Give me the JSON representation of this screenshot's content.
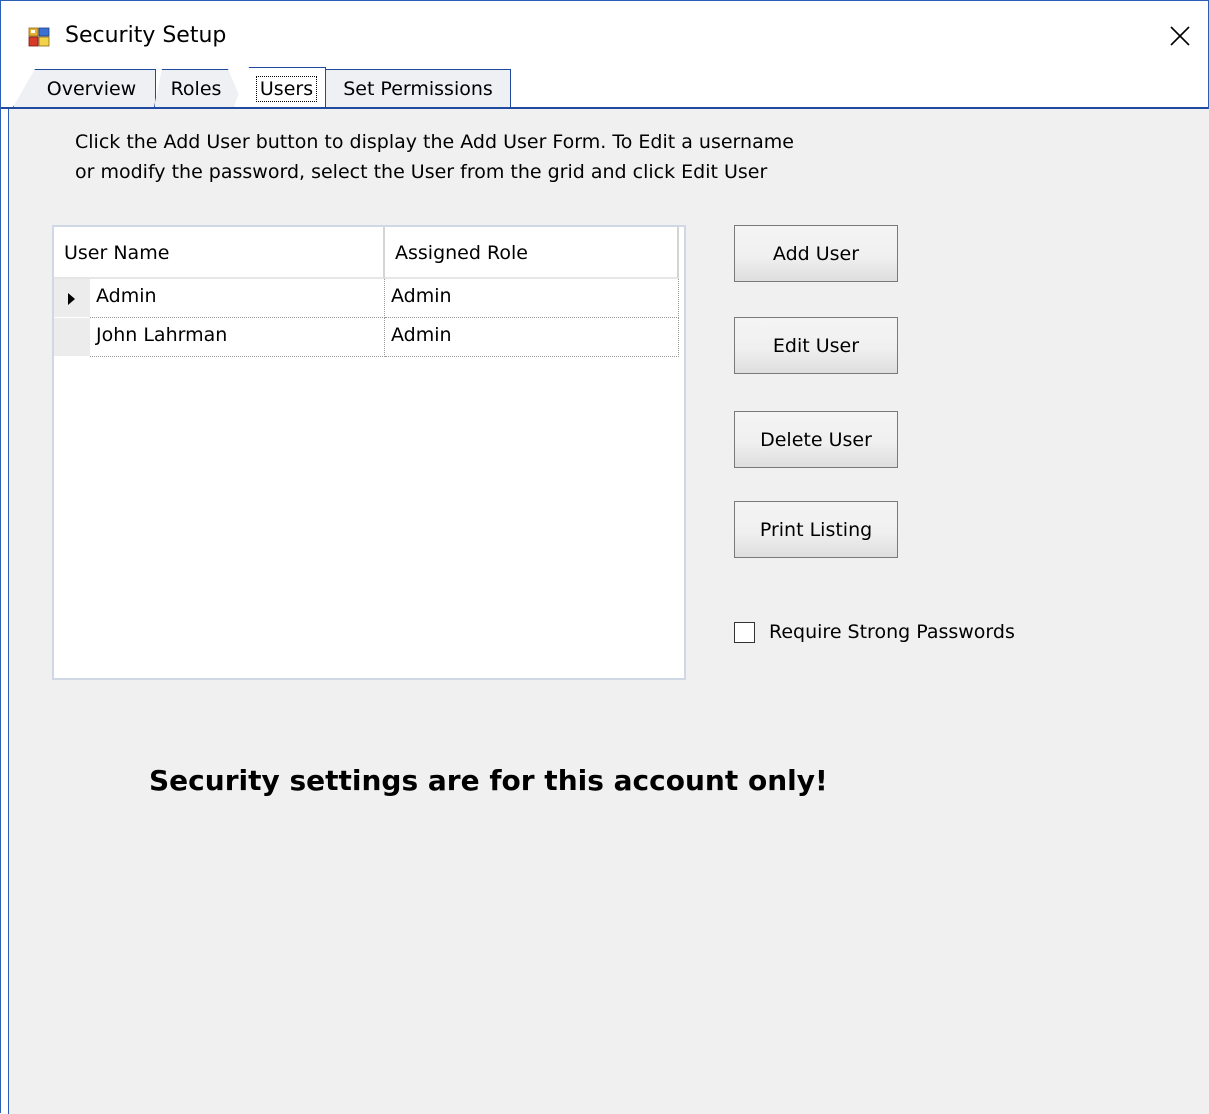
{
  "window": {
    "title": "Security Setup"
  },
  "tabs": [
    {
      "label": "Overview"
    },
    {
      "label": "Roles"
    },
    {
      "label": "Users"
    },
    {
      "label": "Set Permissions"
    }
  ],
  "active_tab": "Users",
  "instructions": {
    "line1": "Click the Add User button to display the Add User Form.  To Edit a username",
    "line2": "or modify the password, select the User from the grid and click Edit User"
  },
  "grid": {
    "columns": [
      "User Name",
      "Assigned Role"
    ],
    "rows": [
      {
        "user_name": "Admin",
        "role": "Admin",
        "current": true
      },
      {
        "user_name": "John Lahrman",
        "role": "Admin",
        "current": false
      }
    ]
  },
  "buttons": {
    "add_user": "Add User",
    "edit_user": "Edit User",
    "delete_user": "Delete User",
    "print_listing": "Print Listing"
  },
  "options": {
    "require_strong_passwords_label": "Require Strong Passwords",
    "require_strong_passwords_checked": false
  },
  "warning": "Security settings are for this account only!",
  "colors": {
    "tab_border": "#1f4aa0",
    "panel_bg": "#f0f0f0"
  }
}
